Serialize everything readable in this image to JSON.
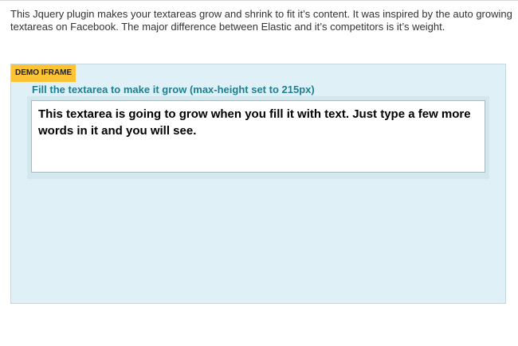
{
  "intro": {
    "text": "This Jquery plugin makes your textareas grow and shrink to fit it’s content. It was inspired by the auto growing textareas on Facebook. The major difference between Elastic and it’s competitors is it’s weight."
  },
  "demo": {
    "badge": "DEMO IFRAME",
    "label": "Fill the textarea to make it grow (max-height set to 215px)",
    "textarea_value": "This textarea is going to grow when you fill it with text. Just type a few more words in it and you will see."
  },
  "colors": {
    "demo_background": "#dff1f7",
    "badge": "#fcc434",
    "label": "#1d7f93"
  }
}
